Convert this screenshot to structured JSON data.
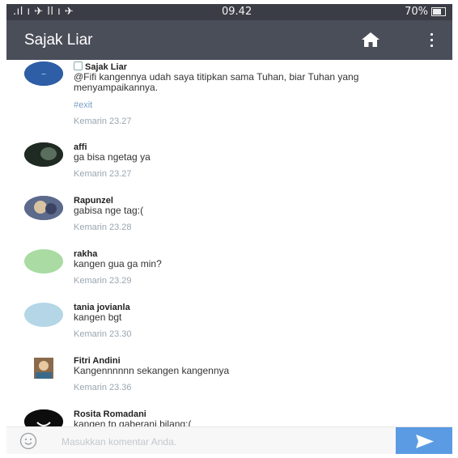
{
  "status_bar": {
    "signal": ".ıl ı ✈ ll ı ✈",
    "time": "09.42",
    "battery": "70%"
  },
  "app_bar": {
    "title": "Sajak Liar",
    "home_icon": "home-icon",
    "more_icon": "more-vert-icon"
  },
  "comments": [
    {
      "name": "Sajak Liar",
      "official": true,
      "text": "@Fifi kangennya udah saya titipkan sama Tuhan, biar Tuhan yang menyampaikannya.",
      "tag": "#exit",
      "time": "Kemarin 23.27"
    },
    {
      "name": "affi",
      "text": "ga bisa ngetag ya",
      "time": "Kemarin 23.27"
    },
    {
      "name": "Rapunzel",
      "text": "gabisa nge tag:(",
      "time": "Kemarin 23.28"
    },
    {
      "name": "rakha",
      "text": "kangen gua ga min?",
      "time": "Kemarin 23.29"
    },
    {
      "name": "tania jovianla",
      "text": "kangen bgt",
      "time": "Kemarin 23.30"
    },
    {
      "name": "Fitri Andini",
      "text": "Kangennnnnn sekangen kangennya",
      "time": "Kemarin 23.36"
    },
    {
      "name": "Rosita Romadani",
      "text": "kangen tp gaberani bilang:(",
      "time": ""
    }
  ],
  "input_bar": {
    "placeholder": "Masukkan komentar Anda.",
    "value": "",
    "emoji_icon": "smiley-icon",
    "send_icon": "send-icon"
  },
  "colors": {
    "status_bar": "#3a3d45",
    "app_bar": "#4a4e59",
    "send_button": "#5b9be3",
    "time_text": "#9aa6b0",
    "tag_text": "#7a9fc8"
  }
}
